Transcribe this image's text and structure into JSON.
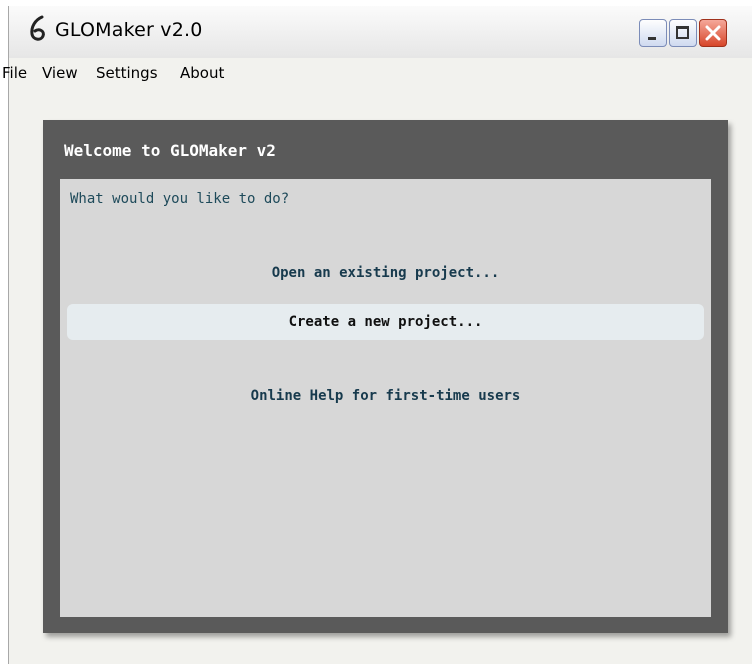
{
  "window": {
    "title": "GLOMaker v2.0",
    "icon": "glomaker-logo-icon",
    "controls": [
      "minimize-icon",
      "maximize-icon",
      "close-icon"
    ]
  },
  "menu": {
    "items": [
      "File",
      "View",
      "Settings",
      "About"
    ]
  },
  "welcome": {
    "title": "Welcome to GLOMaker v2",
    "prompt": "What would you like to do?",
    "actions": [
      {
        "label": "Open an existing project...",
        "highlighted": false
      },
      {
        "label": "Create a new project...",
        "highlighted": true
      },
      {
        "label": "Online Help for first-time users",
        "highlighted": false
      }
    ]
  },
  "colors": {
    "panel_dark": "#5a5a5a",
    "panel_light": "#d7d7d7",
    "highlight": "#e6ecef",
    "action_text": "#173a4d",
    "close_button": "#d7462a"
  }
}
